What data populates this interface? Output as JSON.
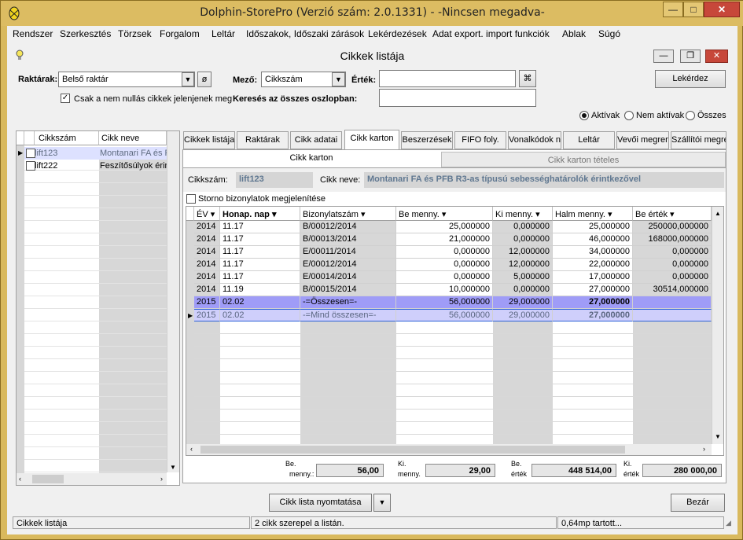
{
  "window": {
    "title": "Dolphin-StorePro  (Verzió szám: 2.0.1331) - -Nincsen megadva-",
    "controls": [
      "minimize-icon",
      "maximize-icon",
      "close-icon"
    ]
  },
  "menu": [
    "Rendszer",
    "Szerkesztés",
    "Törzsek",
    "Forgalom",
    "Leltár",
    "Időszakok, Időszaki zárások",
    "Lekérdezések",
    "Adat export. import funkciók",
    "Ablak",
    "Súgó"
  ],
  "child": {
    "title": "Cikkek listája",
    "controls": [
      "minimize-icon",
      "restore-icon",
      "close-icon"
    ]
  },
  "filters": {
    "warehouse_label": "Raktárak:",
    "warehouse_value": "Belső raktár",
    "field_label": "Mező:",
    "field_value": "Cikkszám",
    "value_label": "Érték:",
    "value_value": "",
    "search_all_label": "Keresés az összes oszlopban:",
    "search_all_value": "",
    "nonzero_label": "Csak a nem nullás cikkek jelenjenek meg",
    "nonzero_checked": "✓",
    "query_button": "Lekérdez",
    "radio_active": "Aktívak",
    "radio_inactive": "Nem aktívak",
    "radio_all": "Összes"
  },
  "left_grid": {
    "headers": [
      "Cikkszám",
      "Cikk neve"
    ],
    "rows": [
      [
        "lift123",
        "Montanari FA és P"
      ],
      [
        "lift222",
        "Feszítősúlyok érin"
      ]
    ]
  },
  "tabs": [
    "Cikkek listája",
    "Raktárak",
    "Cikk adatai",
    "Cikk karton",
    "Beszerzések",
    "FIFO foly.",
    "Vonalkódok n",
    "Leltár",
    "Vevői megren",
    "Szállítói megre"
  ],
  "subtabs": [
    "Cikk karton",
    "Cikk karton tételes"
  ],
  "item": {
    "code_label": "Cikkszám:",
    "code_value": "lift123",
    "name_label": "Cikk neve:",
    "name_value": "Montanari FA és PFB R3-as típusú sebességhatárolók érintkezővel"
  },
  "storno": {
    "label": "Storno bizonylatok megjelenítése"
  },
  "grid": {
    "headers": [
      "ÉV ▾",
      "Honap. nap ▾",
      "Bizonylatszám ▾",
      "Be menny. ▾",
      "Ki menny. ▾",
      "Halm menny. ▾",
      "Be érték ▾"
    ],
    "rows": [
      [
        "2014",
        "11.17",
        "B/00012/2014",
        "25,000000",
        "0,000000",
        "25,000000",
        "250000,000000"
      ],
      [
        "2014",
        "11.17",
        "B/00013/2014",
        "21,000000",
        "0,000000",
        "46,000000",
        "168000,000000"
      ],
      [
        "2014",
        "11.17",
        "E/00011/2014",
        "0,000000",
        "12,000000",
        "34,000000",
        "0,000000"
      ],
      [
        "2014",
        "11.17",
        "E/00012/2014",
        "0,000000",
        "12,000000",
        "22,000000",
        "0,000000"
      ],
      [
        "2014",
        "11.17",
        "E/00014/2014",
        "0,000000",
        "5,000000",
        "17,000000",
        "0,000000"
      ],
      [
        "2014",
        "11.19",
        "B/00015/2014",
        "10,000000",
        "0,000000",
        "27,000000",
        "30514,000000"
      ]
    ],
    "subtotal": [
      "2015",
      "02.02",
      "-=Összesen=-",
      "56,000000",
      "29,000000",
      "27,000000",
      ""
    ],
    "total": [
      "2015",
      "02.02",
      "-=Mind összesen=-",
      "56,000000",
      "29,000000",
      "27,000000",
      ""
    ]
  },
  "summary": [
    {
      "label_1": "Be.",
      "label_2": "menny.:",
      "value": "56,00"
    },
    {
      "label_1": "Ki.",
      "label_2": "menny.",
      "value": "29,00"
    },
    {
      "label_1": "Be.",
      "label_2": "érték",
      "value": "448 514,00"
    },
    {
      "label_1": "Ki.",
      "label_2": "érték",
      "value": "280 000,00"
    }
  ],
  "bottom": {
    "print_button": "Cikk lista nyomtatása",
    "close_button": "Bezár"
  },
  "status": [
    "Cikkek listája",
    "2 cikk szerepel a listán.",
    "0,64mp tartott..."
  ]
}
